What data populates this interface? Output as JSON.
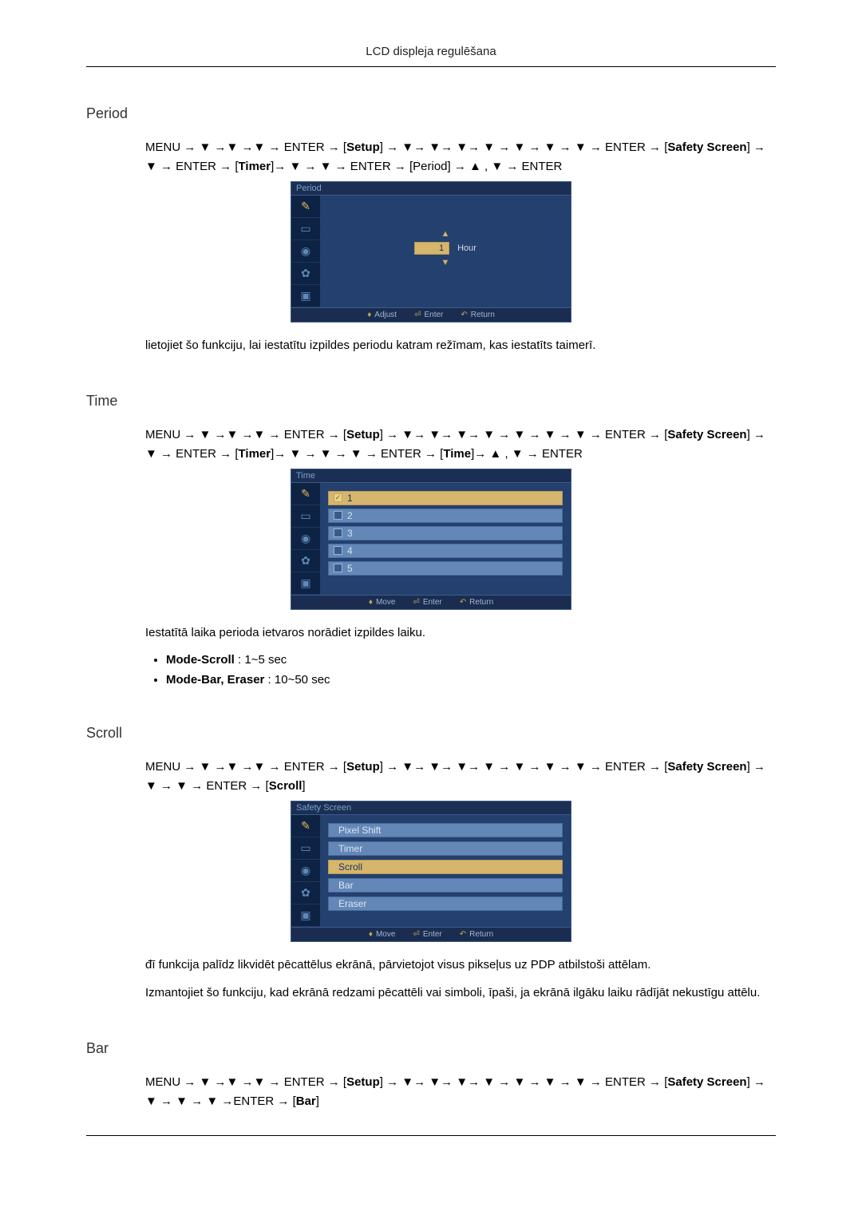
{
  "header": {
    "title": "LCD displeja regulēšana"
  },
  "arrow": "→",
  "down": "▼",
  "up": "▲",
  "nav_tokens": {
    "menu": "MENU",
    "enter": "ENTER",
    "setup": "Setup",
    "safety_screen": "Safety Screen",
    "timer": "Timer",
    "period": "Period",
    "time": "Time",
    "scroll": "Scroll",
    "bar": "Bar",
    "comma": " ,"
  },
  "sections": {
    "period": {
      "heading": "Period",
      "osd_title": "Period",
      "value": "1",
      "unit": "Hour",
      "footer": {
        "adjust": "Adjust",
        "enter": "Enter",
        "return": "Return"
      },
      "para": "lietojiet šo funkciju, lai iestatītu izpildes periodu katram režīmam, kas iestatīts taimerī."
    },
    "time": {
      "heading": "Time",
      "osd_title": "Time",
      "items": [
        "1",
        "2",
        "3",
        "4",
        "5"
      ],
      "selected_index": 0,
      "footer": {
        "move": "Move",
        "enter": "Enter",
        "return": "Return"
      },
      "para": "Iestatītā laika perioda ietvaros norādiet izpildes laiku.",
      "bullets": [
        {
          "label": "Mode-Scroll",
          "rest": " : 1~5 sec"
        },
        {
          "label": "Mode-Bar, Eraser",
          "rest": " : 10~50 sec"
        }
      ]
    },
    "scroll": {
      "heading": "Scroll",
      "osd_title": "Safety Screen",
      "items": [
        "Pixel Shift",
        "Timer",
        "Scroll",
        "Bar",
        "Eraser"
      ],
      "selected_index": 2,
      "footer": {
        "move": "Move",
        "enter": "Enter",
        "return": "Return"
      },
      "para1": "đī funkcija palīdz likvidēt pēcattēlus ekrānā, pārvietojot visus pikseļus uz PDP atbilstoši attēlam.",
      "para2": "Izmantojiet šo funkciju, kad ekrānā redzami pēcattēli vai simboli, īpaši, ja ekrānā ilgāku laiku rādījāt nekustīgu attēlu."
    },
    "bar": {
      "heading": "Bar"
    }
  },
  "icons": [
    "brush",
    "pip",
    "power",
    "gear",
    "image"
  ]
}
